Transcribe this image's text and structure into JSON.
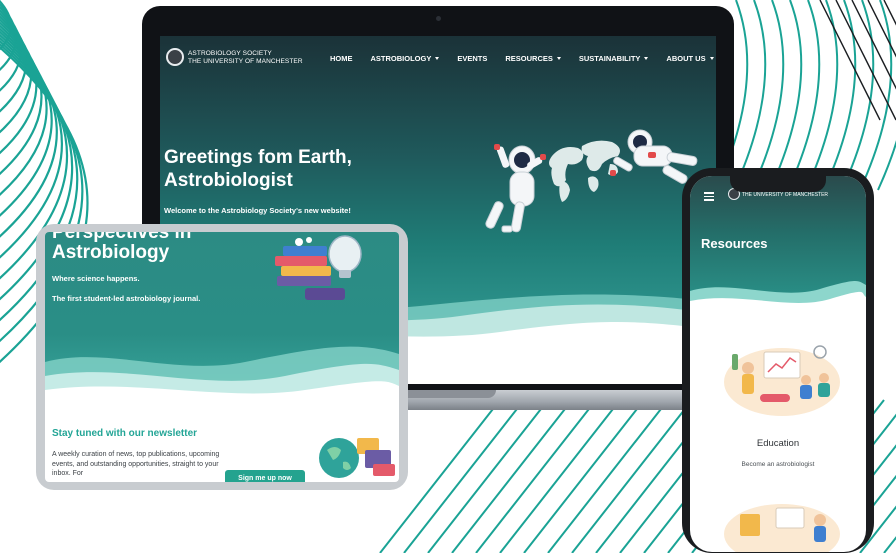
{
  "colors": {
    "brand_teal": "#1f7d77",
    "accent_green": "#24a38f",
    "newsletter_title": "#23a596",
    "bg_line": "#1aa395",
    "bg_line_dark": "#1b1e22"
  },
  "laptop": {
    "logo": {
      "icon": "university-seal-icon",
      "line1": "ASTROBIOLOGY SOCIETY",
      "line2": "THE UNIVERSITY OF MANCHESTER"
    },
    "nav": [
      {
        "label": "HOME",
        "dropdown": false
      },
      {
        "label": "ASTROBIOLOGY",
        "dropdown": true
      },
      {
        "label": "EVENTS",
        "dropdown": false
      },
      {
        "label": "RESOURCES",
        "dropdown": true
      },
      {
        "label": "SUSTAINABILITY",
        "dropdown": true
      },
      {
        "label": "ABOUT US",
        "dropdown": true
      }
    ],
    "hero": {
      "title_line1": "Greetings fom Earth,",
      "title_line2": "Astrobiologist",
      "subtitle": "Welcome to the Astrobiology Society's new website!"
    }
  },
  "tablet": {
    "hero": {
      "title_cut": "Perspectives in",
      "title": "Astrobiology",
      "line1": "Where science happens.",
      "line2": "The first student-led astrobiology journal."
    },
    "newsletter": {
      "title": "Stay tuned with our newsletter",
      "body": "A weekly curation of news, top publications, upcoming events, and outstanding opportunities, straight to your inbox. For",
      "button": "Sign me up now"
    }
  },
  "phone": {
    "logo_text": "THE UNIVERSITY OF MANCHESTER",
    "title": "Resources",
    "card": {
      "label": "Education",
      "sub": "Become an astrobiologist"
    }
  }
}
